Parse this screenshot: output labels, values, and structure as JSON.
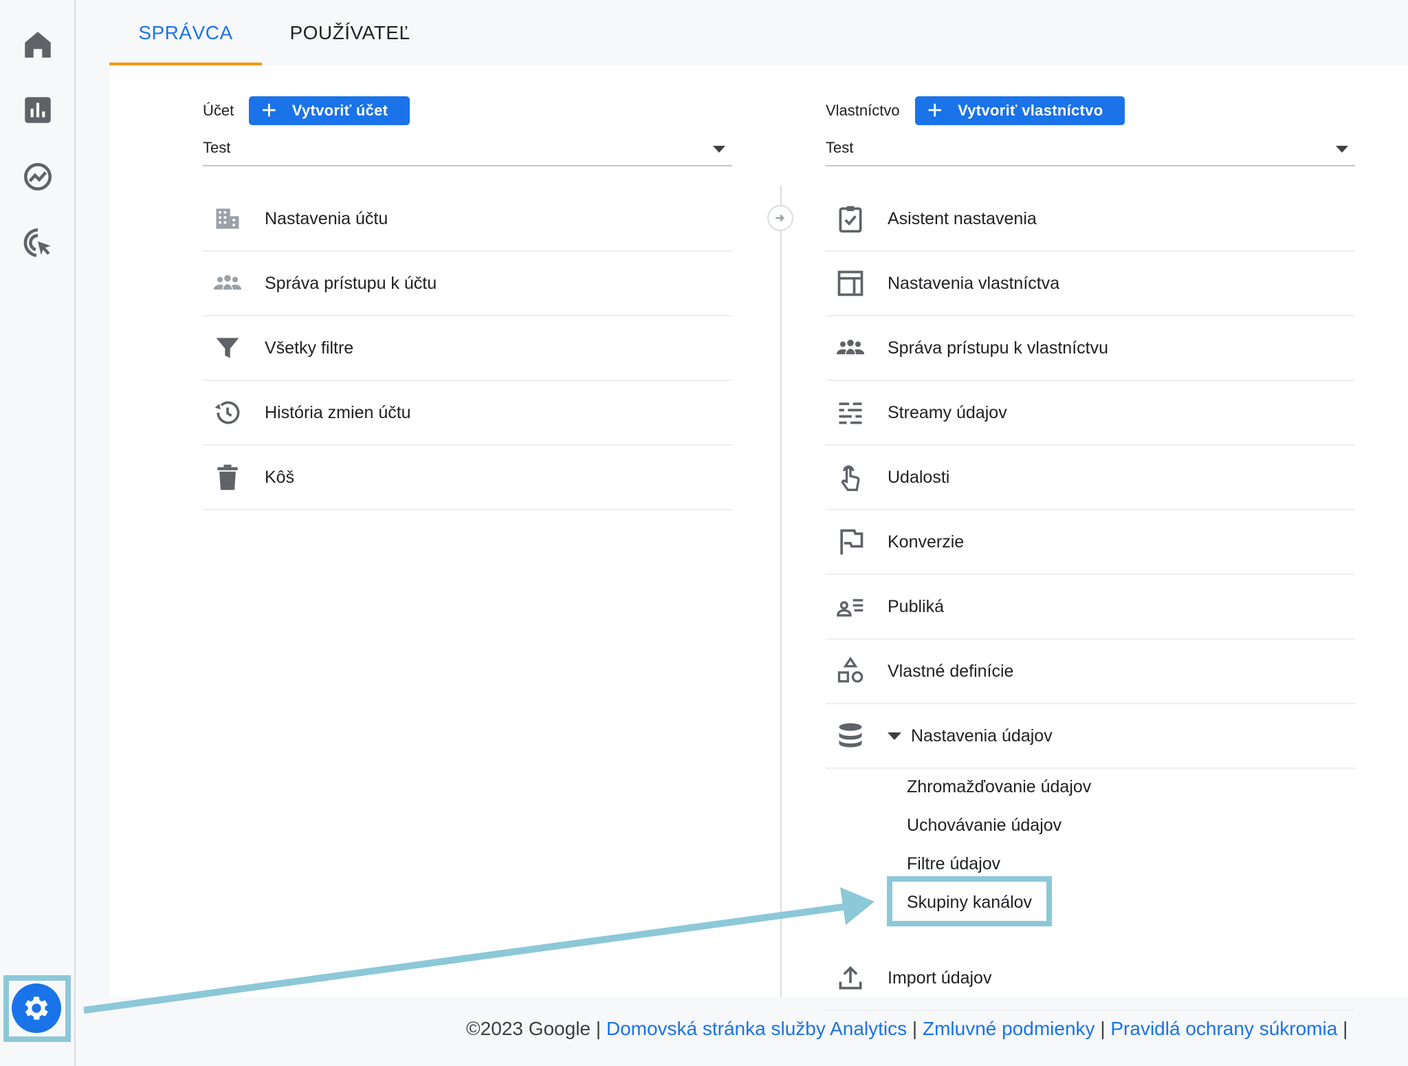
{
  "tabs": {
    "admin": "SPRÁVCA",
    "user": "POUŽÍVATEĽ"
  },
  "account": {
    "label": "Účet",
    "create_button": "Vytvoriť účet",
    "selected": "Test",
    "menu": [
      {
        "label": "Nastavenia účtu",
        "icon": "building-icon"
      },
      {
        "label": "Správa prístupu k účtu",
        "icon": "people-icon"
      },
      {
        "label": "Všetky filtre",
        "icon": "filter-icon"
      },
      {
        "label": "História zmien účtu",
        "icon": "history-icon"
      },
      {
        "label": "Kôš",
        "icon": "trash-icon"
      }
    ]
  },
  "property": {
    "label": "Vlastníctvo",
    "create_button": "Vytvoriť vlastníctvo",
    "selected": "Test",
    "menu": [
      {
        "label": "Asistent nastavenia",
        "icon": "checklist-icon"
      },
      {
        "label": "Nastavenia vlastníctva",
        "icon": "layout-icon"
      },
      {
        "label": "Správa prístupu k vlastníctvu",
        "icon": "people-icon"
      },
      {
        "label": "Streamy údajov",
        "icon": "streams-icon"
      },
      {
        "label": "Udalosti",
        "icon": "touch-icon"
      },
      {
        "label": "Konverzie",
        "icon": "flag-icon"
      },
      {
        "label": "Publiká",
        "icon": "audience-icon"
      },
      {
        "label": "Vlastné definície",
        "icon": "shapes-icon"
      },
      {
        "label": "Nastavenia údajov",
        "icon": "database-icon"
      }
    ],
    "data_settings_sub": [
      "Zhromažďovanie údajov",
      "Uchovávanie údajov",
      "Filtre údajov",
      "Skupiny kanálov"
    ],
    "import": {
      "label": "Import údajov",
      "icon": "upload-icon"
    }
  },
  "footer": {
    "copyright": "©2023 Google",
    "sep": "|",
    "link1": "Domovská stránka služby Analytics",
    "link2": "Zmluvné podmienky",
    "link3": "Pravidlá ochrany súkromia"
  },
  "colors": {
    "accent": "#1a73e8",
    "tab_underline": "#f29900",
    "annotation": "#8cc8d8"
  }
}
